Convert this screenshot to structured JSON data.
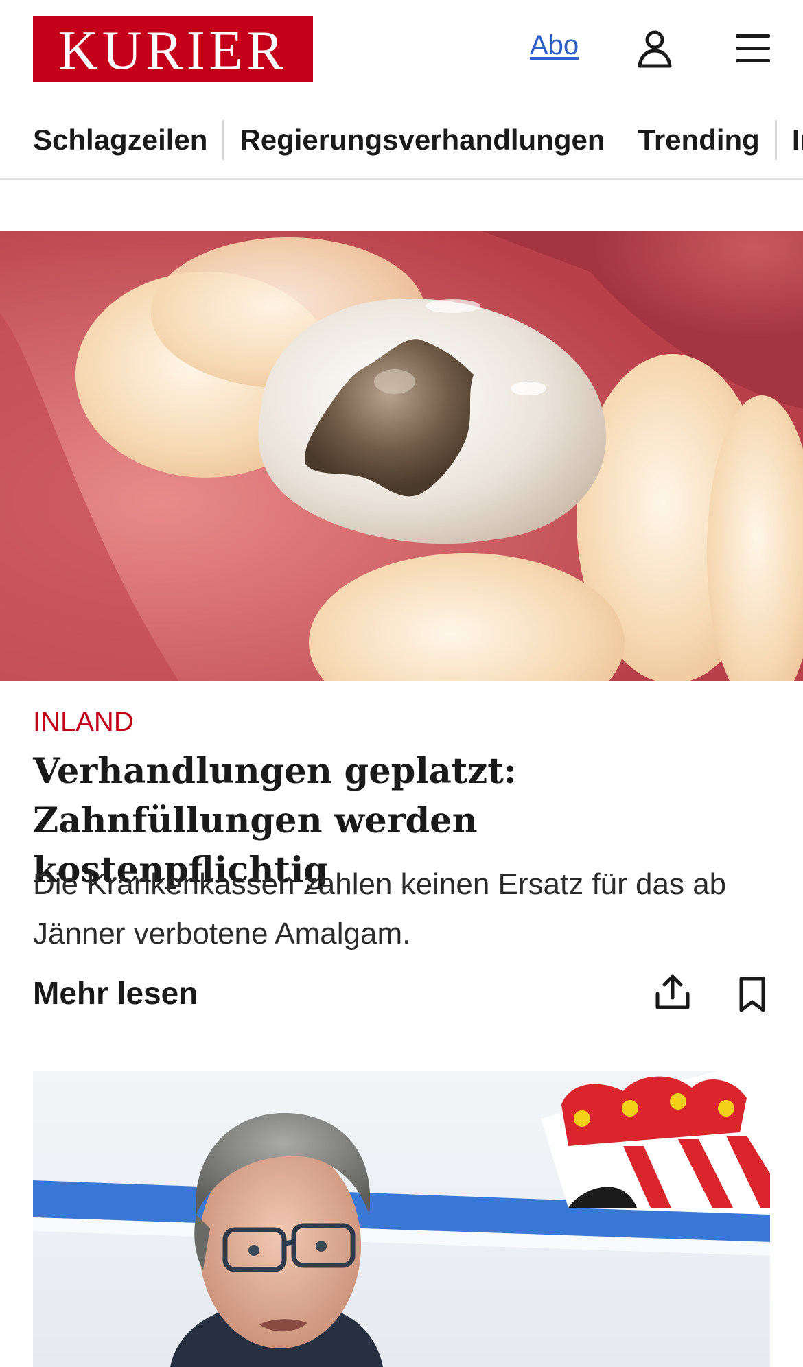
{
  "header": {
    "logo_text": "KURIER",
    "abo_label": "Abo",
    "user_icon": "user-icon",
    "menu_icon": "hamburger-menu-icon",
    "brand_color": "#c4001a",
    "link_color": "#2f5fc9"
  },
  "section_nav": {
    "tabs": [
      {
        "label": "Schlagzeilen"
      },
      {
        "label": "Regierungsverhandlungen"
      },
      {
        "label": "Trending"
      },
      {
        "label": "Inla"
      }
    ]
  },
  "articles": [
    {
      "category": "INLAND",
      "headline": "Verhandlungen geplatzt: Zahnfüllungen werden kostenpflichtig",
      "teaser": "Die Krankenkassen zahlen keinen Ersatz für das ab Jänner verbotene Amalgam.",
      "more_label": "Mehr lesen",
      "share_icon": "share-icon",
      "bookmark_icon": "bookmark-icon"
    }
  ]
}
